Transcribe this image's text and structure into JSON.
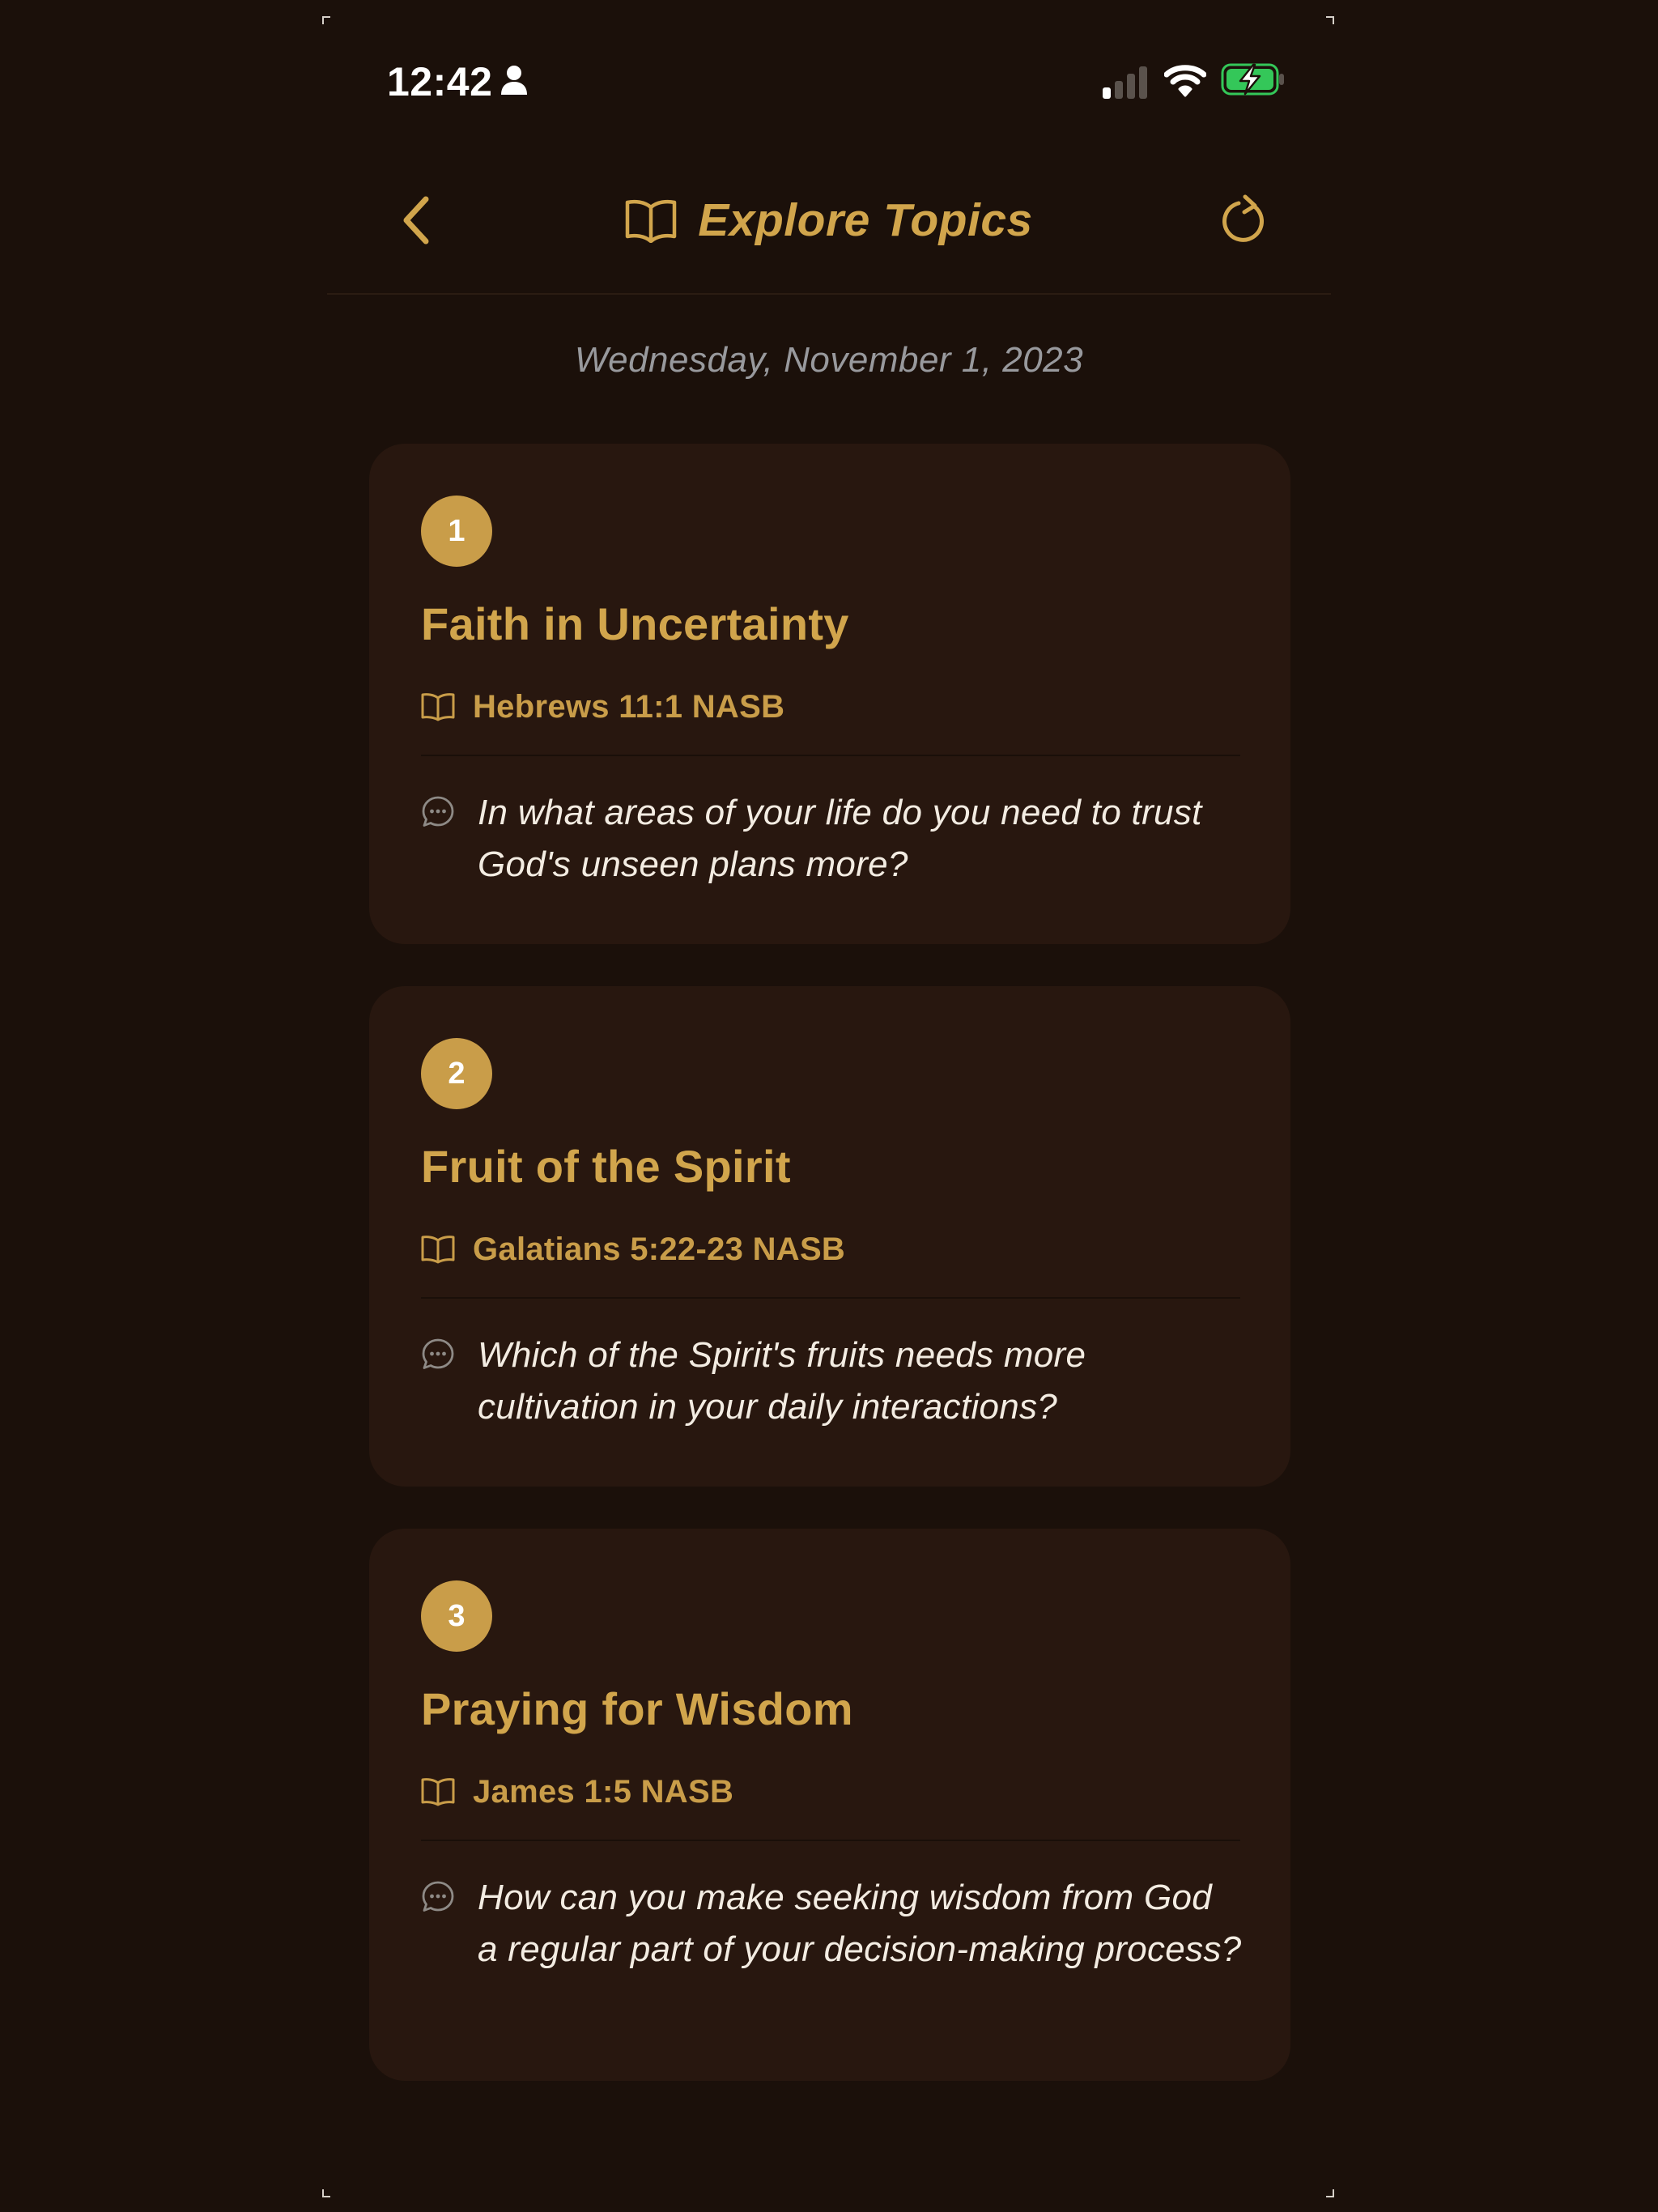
{
  "status_bar": {
    "time": "12:42",
    "icons": [
      "person-icon",
      "cellular-signal-icon",
      "wifi-icon",
      "battery-charging-icon"
    ]
  },
  "nav": {
    "title": "Explore Topics",
    "back_icon": "chevron-left-icon",
    "title_icon": "open-book-icon",
    "refresh_icon": "refresh-icon"
  },
  "date_label": "Wednesday, November 1, 2023",
  "colors": {
    "background": "#1b100a",
    "card": "#28170f",
    "accent_gold": "#d1a54c",
    "badge_gold": "#c99d49",
    "date_gray": "#98999d",
    "question_text": "#f3ece2",
    "battery_green": "#34c759"
  },
  "topics": [
    {
      "number": "1",
      "title": "Faith in Uncertainty",
      "reference": "Hebrews 11:1 NASB",
      "question": "In what areas of your life do you need to trust God's unseen plans more?"
    },
    {
      "number": "2",
      "title": "Fruit of the Spirit",
      "reference": "Galatians 5:22-23 NASB",
      "question": "Which of the Spirit's fruits needs more cultivation in your daily interactions?"
    },
    {
      "number": "3",
      "title": "Praying for Wisdom",
      "reference": "James 1:5 NASB",
      "question": "How can you make seeking wisdom from God a regular part of your decision-making process?"
    }
  ]
}
